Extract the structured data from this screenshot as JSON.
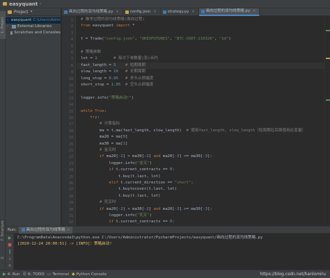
{
  "title_bar": {
    "project_name": "easyquant"
  },
  "left_strip": {
    "project_tab": "1: Project",
    "structure_tab": "7: Structure",
    "favorites_tab": "2: Favorites"
  },
  "project_panel": {
    "header": "Project",
    "tree": [
      {
        "name": "easyquant",
        "path": "C:\\Users\\Admini",
        "icon": "folder"
      },
      {
        "name": "External Libraries",
        "path": "",
        "icon": "library"
      },
      {
        "name": "Scratches and Consoles",
        "path": "",
        "icon": "scratch"
      }
    ]
  },
  "tabs": [
    {
      "label": "画向过程的双均线策略.py",
      "icon": "python-file",
      "active": false
    },
    {
      "label": "config.json",
      "icon": "json-file",
      "active": false
    },
    {
      "label": "strategy.py",
      "icon": "python-file",
      "active": false
    },
    {
      "label": "画向过程的双均线策略.py",
      "icon": "python-file",
      "active": true
    }
  ],
  "code_lines": [
    {
      "n": "1",
      "segments": [
        {
          "t": "# 推举过程的双均线策略(面向过程)",
          "c": "#808080"
        }
      ]
    },
    {
      "n": "2",
      "segments": [
        {
          "t": "from",
          "c": "#cc7832"
        },
        {
          "t": " easyquant ",
          "c": "#a9b7c6"
        },
        {
          "t": "import",
          "c": "#cc7832"
        },
        {
          "t": " *",
          "c": "#a9b7c6"
        }
      ]
    },
    {
      "n": "3",
      "segments": []
    },
    {
      "n": "4",
      "segments": [
        {
          "t": "t = Trade(",
          "c": "#a9b7c6"
        },
        {
          "t": "\"config.json\"",
          "c": "#6a8759"
        },
        {
          "t": ", ",
          "c": "#a9b7c6"
        },
        {
          "t": "\"OKEXFUTURES\"",
          "c": "#6a8759"
        },
        {
          "t": ", ",
          "c": "#a9b7c6"
        },
        {
          "t": "\"BTC-USDT-210326\"",
          "c": "#6a8759"
        },
        {
          "t": ", ",
          "c": "#a9b7c6"
        },
        {
          "t": "\"1d\"",
          "c": "#6a8759"
        },
        {
          "t": ")",
          "c": "#a9b7c6"
        }
      ]
    },
    {
      "n": "5",
      "segments": []
    },
    {
      "n": "6",
      "segments": [
        {
          "t": "# 策略参数",
          "c": "#808080"
        }
      ]
    },
    {
      "n": "7",
      "segments": [
        {
          "t": "lot = ",
          "c": "#a9b7c6"
        },
        {
          "t": "1",
          "c": "#6897bb"
        },
        {
          "t": "       ",
          "c": "#a9b7c6"
        },
        {
          "t": "# 每次下单数量(张)合约",
          "c": "#808080"
        }
      ]
    },
    {
      "n": "8",
      "segments": [
        {
          "t": "fast_length = ",
          "c": "#a9b7c6"
        },
        {
          "t": "5",
          "c": "#6897bb"
        },
        {
          "t": "    ",
          "c": "#a9b7c6"
        },
        {
          "t": "# 短期周期",
          "c": "#808080"
        }
      ],
      "current": true
    },
    {
      "n": "9",
      "segments": [
        {
          "t": "slow_length = ",
          "c": "#a9b7c6"
        },
        {
          "t": "10",
          "c": "#6897bb"
        },
        {
          "t": "   ",
          "c": "#a9b7c6"
        },
        {
          "t": "# 长期周期",
          "c": "#808080"
        }
      ]
    },
    {
      "n": "10",
      "segments": [
        {
          "t": "long_stop = ",
          "c": "#a9b7c6"
        },
        {
          "t": "0.95",
          "c": "#6897bb"
        },
        {
          "t": "   ",
          "c": "#a9b7c6"
        },
        {
          "t": "# 多头止损幅度",
          "c": "#808080"
        }
      ]
    },
    {
      "n": "11",
      "segments": [
        {
          "t": "short_stop = ",
          "c": "#a9b7c6"
        },
        {
          "t": "1.05",
          "c": "#6897bb"
        },
        {
          "t": "  ",
          "c": "#a9b7c6"
        },
        {
          "t": "# 空头止损幅度",
          "c": "#808080"
        }
      ]
    },
    {
      "n": "12",
      "segments": []
    },
    {
      "n": "13",
      "segments": [
        {
          "t": "logger.info(",
          "c": "#a9b7c6"
        },
        {
          "t": "\"策略启动!\"",
          "c": "#6a8759"
        },
        {
          "t": ")",
          "c": "#a9b7c6"
        }
      ]
    },
    {
      "n": "14",
      "segments": []
    },
    {
      "n": "15",
      "segments": [
        {
          "t": "while",
          "c": "#cc7832"
        },
        {
          "t": " ",
          "c": "#a9b7c6"
        },
        {
          "t": "True",
          "c": "#cc7832"
        },
        {
          "t": ":",
          "c": "#a9b7c6"
        }
      ]
    },
    {
      "n": "16",
      "segments": [
        {
          "t": "    try",
          "c": "#cc7832"
        },
        {
          "t": ":",
          "c": "#a9b7c6"
        }
      ]
    },
    {
      "n": "17",
      "segments": [
        {
          "t": "        # 计算指标",
          "c": "#808080"
        }
      ]
    },
    {
      "n": "18",
      "segments": [
        {
          "t": "        ma = t.ma(fast_length, slow_length)",
          "c": "#a9b7c6"
        },
        {
          "t": "  # 使用fast_length, slow_length（短周期在后面使用此变量）",
          "c": "#808080"
        }
      ]
    },
    {
      "n": "19",
      "segments": [
        {
          "t": "        ma20 = ma[",
          "c": "#a9b7c6"
        },
        {
          "t": "0",
          "c": "#6897bb"
        },
        {
          "t": "]",
          "c": "#a9b7c6"
        }
      ]
    },
    {
      "n": "20",
      "segments": [
        {
          "t": "        ma30 = ma[",
          "c": "#a9b7c6"
        },
        {
          "t": "1",
          "c": "#6897bb"
        },
        {
          "t": "]",
          "c": "#a9b7c6"
        }
      ]
    },
    {
      "n": "21",
      "segments": [
        {
          "t": "        # 金叉时",
          "c": "#808080"
        }
      ]
    },
    {
      "n": "22",
      "segments": [
        {
          "t": "        if",
          "c": "#cc7832"
        },
        {
          "t": " ma20[",
          "c": "#a9b7c6"
        },
        {
          "t": "-2",
          "c": "#6897bb"
        },
        {
          "t": "] > ma30[",
          "c": "#a9b7c6"
        },
        {
          "t": "-2",
          "c": "#6897bb"
        },
        {
          "t": "] ",
          "c": "#a9b7c6"
        },
        {
          "t": "and",
          "c": "#cc7832"
        },
        {
          "t": " ma20[",
          "c": "#a9b7c6"
        },
        {
          "t": "-3",
          "c": "#6897bb"
        },
        {
          "t": "] <= ma30[",
          "c": "#a9b7c6"
        },
        {
          "t": "-3",
          "c": "#6897bb"
        },
        {
          "t": "]:",
          "c": "#a9b7c6"
        }
      ]
    },
    {
      "n": "23",
      "segments": [
        {
          "t": "            logger.info(",
          "c": "#a9b7c6"
        },
        {
          "t": "\"金叉\"",
          "c": "#6a8759"
        },
        {
          "t": ")",
          "c": "#a9b7c6"
        }
      ]
    },
    {
      "n": "24",
      "segments": [
        {
          "t": "            if",
          "c": "#cc7832"
        },
        {
          "t": " t.current_contracts == ",
          "c": "#a9b7c6"
        },
        {
          "t": "0",
          "c": "#6897bb"
        },
        {
          "t": ":",
          "c": "#a9b7c6"
        }
      ]
    },
    {
      "n": "25",
      "segments": [
        {
          "t": "                t.buy(t.last, lot)",
          "c": "#a9b7c6"
        }
      ]
    },
    {
      "n": "26",
      "segments": [
        {
          "t": "            elif",
          "c": "#cc7832"
        },
        {
          "t": " t.current_direction == ",
          "c": "#a9b7c6"
        },
        {
          "t": "\"short\"",
          "c": "#6a8759"
        },
        {
          "t": ":",
          "c": "#a9b7c6"
        }
      ]
    },
    {
      "n": "27",
      "segments": [
        {
          "t": "                t.buytocover(t.last, lot)",
          "c": "#a9b7c6"
        }
      ]
    },
    {
      "n": "28",
      "segments": [
        {
          "t": "                t.buy(t.last, lot)",
          "c": "#a9b7c6"
        }
      ]
    },
    {
      "n": "29",
      "segments": [
        {
          "t": "        # 死叉时",
          "c": "#808080"
        }
      ]
    },
    {
      "n": "30",
      "segments": [
        {
          "t": "        if",
          "c": "#cc7832"
        },
        {
          "t": " ma20[",
          "c": "#a9b7c6"
        },
        {
          "t": "-2",
          "c": "#6897bb"
        },
        {
          "t": "] < ma30[",
          "c": "#a9b7c6"
        },
        {
          "t": "-2",
          "c": "#6897bb"
        },
        {
          "t": "] ",
          "c": "#a9b7c6"
        },
        {
          "t": "and",
          "c": "#cc7832"
        },
        {
          "t": " ma20[",
          "c": "#a9b7c6"
        },
        {
          "t": "-3",
          "c": "#6897bb"
        },
        {
          "t": "] >= ma30[",
          "c": "#a9b7c6"
        },
        {
          "t": "-3",
          "c": "#6897bb"
        },
        {
          "t": "]:",
          "c": "#a9b7c6"
        }
      ]
    },
    {
      "n": "31",
      "segments": [
        {
          "t": "            logger.info(",
          "c": "#a9b7c6"
        },
        {
          "t": "\"死叉\"",
          "c": "#6a8759"
        },
        {
          "t": ")",
          "c": "#a9b7c6"
        }
      ]
    },
    {
      "n": "32",
      "segments": [
        {
          "t": "            if",
          "c": "#cc7832"
        },
        {
          "t": " t.current_contracts == ",
          "c": "#a9b7c6"
        },
        {
          "t": "0",
          "c": "#6897bb"
        },
        {
          "t": ":",
          "c": "#a9b7c6"
        }
      ]
    }
  ],
  "run_panel": {
    "label": "Run:",
    "tab": "画向过程的双均线策略",
    "console_lines": [
      {
        "t": "C:\\ProgramData\\Anaconda3\\python.exe C:/Users/Administrator/PycharmProjects/easyquant/画向过程的双均线策略.py",
        "c": "#a9b7c6"
      },
      {
        "t": "[2020-12-24  20:00:51] -> [INFO]：策略启动!",
        "c": "#e8bf6a"
      }
    ]
  },
  "bottom_bar": {
    "items": [
      {
        "label": "4: Run",
        "icon": "run-icon"
      },
      {
        "label": "6: TODO",
        "icon": "todo-icon"
      },
      {
        "label": "Terminal",
        "icon": "terminal-icon"
      },
      {
        "label": "Python Console",
        "icon": "python-console-icon"
      }
    ],
    "watermark": "https://blog.csdn.net/hanlomiru"
  }
}
